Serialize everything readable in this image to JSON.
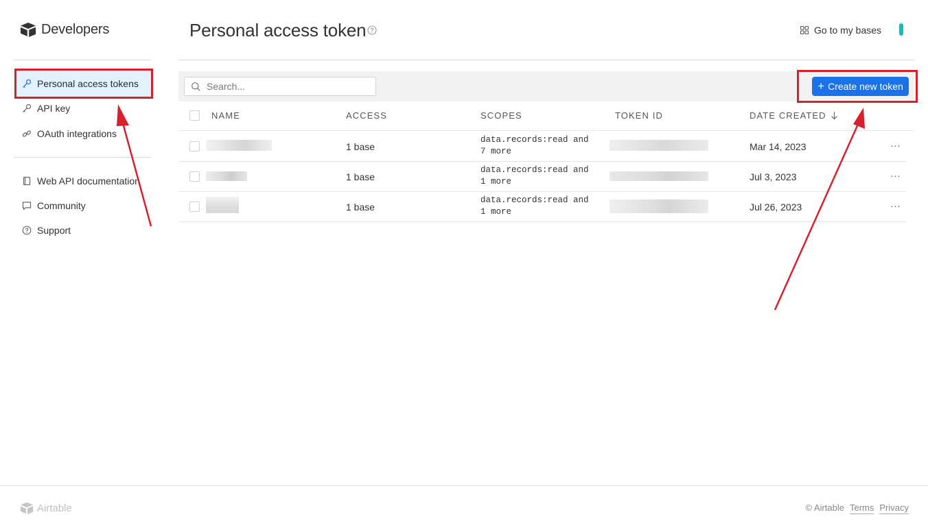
{
  "sidebar": {
    "brand": "Developers",
    "items": [
      {
        "label": "Personal access tokens",
        "icon": "key-icon",
        "active": true
      },
      {
        "label": "API key",
        "icon": "key-icon",
        "active": false
      },
      {
        "label": "OAuth integrations",
        "icon": "link-icon",
        "active": false
      },
      {
        "label": "Web API documentation",
        "icon": "book-icon",
        "active": false
      },
      {
        "label": "Community",
        "icon": "chat-icon",
        "active": false
      },
      {
        "label": "Support",
        "icon": "question-circle-icon",
        "active": false
      }
    ]
  },
  "header": {
    "title": "Personal access token",
    "goto_label": "Go to my bases"
  },
  "toolbar": {
    "search_placeholder": "Search...",
    "create_label": "Create new token"
  },
  "table": {
    "columns": [
      "NAME",
      "ACCESS",
      "SCOPES",
      "TOKEN ID",
      "DATE CREATED"
    ],
    "sort_column": "DATE CREATED",
    "rows": [
      {
        "access": "1 base",
        "scopes_line1": "data.records:read and",
        "scopes_line2": "7 more",
        "date": "Mar 14, 2023",
        "actions": "···"
      },
      {
        "access": "1 base",
        "scopes_line1": "data.records:read and",
        "scopes_line2": "1 more",
        "date": "Jul 3, 2023",
        "actions": "···"
      },
      {
        "access": "1 base",
        "scopes_line1": "data.records:read and",
        "scopes_line2": "1 more",
        "date": "Jul 26, 2023",
        "actions": "···"
      }
    ]
  },
  "footer": {
    "brand": "Airtable",
    "copyright": "© Airtable",
    "terms": "Terms",
    "privacy": "Privacy"
  },
  "colors": {
    "accent": "#1b72e8",
    "active_bg": "#e2f1fb",
    "annotation_red": "#d8202a"
  }
}
